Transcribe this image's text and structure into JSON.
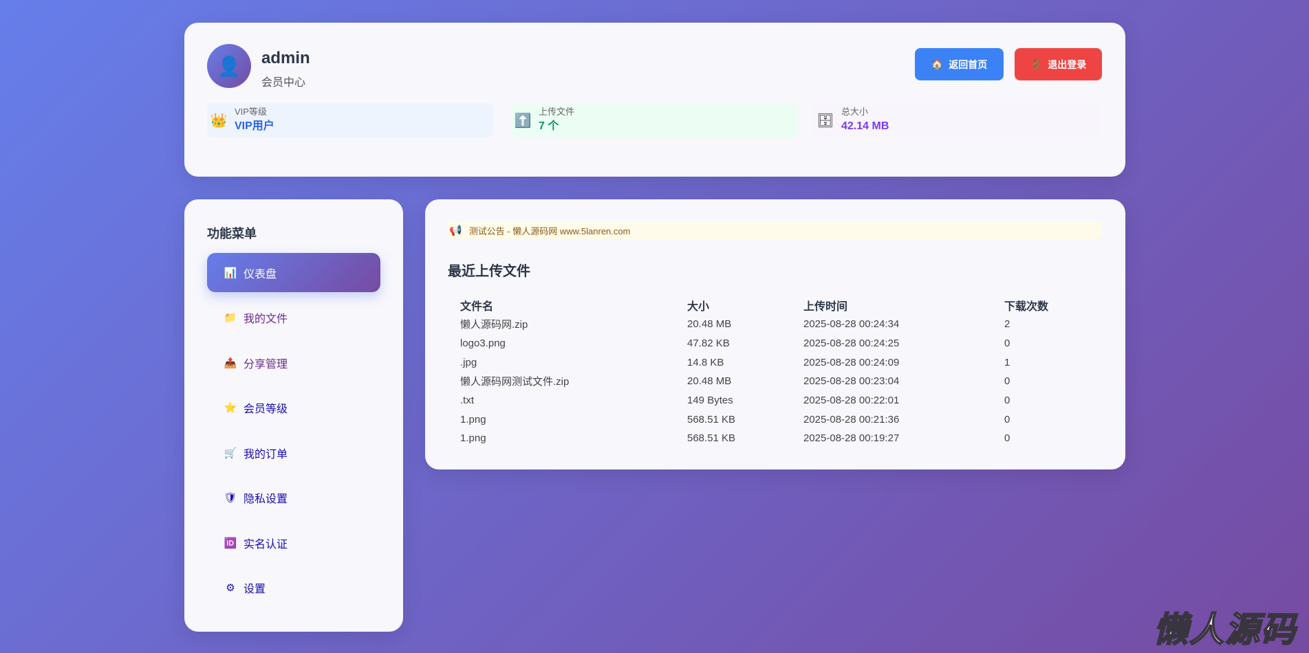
{
  "user": {
    "name": "admin",
    "subtitle": "会员中心",
    "avatar_icon": "person-icon"
  },
  "header": {
    "home_label": "返回首页",
    "logout_label": "退出登录"
  },
  "stats": [
    {
      "label": "VIP等级",
      "value": "VIP用户",
      "icon": "crown-icon",
      "color": "#2563eb",
      "bg": "#eef4fe"
    },
    {
      "label": "上传文件",
      "value": "7 个",
      "icon": "upload-arrow-icon",
      "color": "#059669",
      "bg": "#ecfdf3"
    },
    {
      "label": "总大小",
      "value": "42.14 MB",
      "icon": "storage-icon",
      "color": "#7c3aed",
      "bg": "#f8f5fd"
    }
  ],
  "sidebar": {
    "title": "功能菜单",
    "items": [
      {
        "label": "仪表盘",
        "icon": "chart-icon"
      },
      {
        "label": "我的文件",
        "icon": "folder-icon"
      },
      {
        "label": "分享管理",
        "icon": "share-upload-icon"
      },
      {
        "label": "会员等级",
        "icon": "star-icon"
      },
      {
        "label": "我的订单",
        "icon": "cart-icon"
      },
      {
        "label": "隐私设置",
        "icon": "shield-icon"
      },
      {
        "label": "实名认证",
        "icon": "id-icon"
      },
      {
        "label": "设置",
        "icon": "gear-icon"
      }
    ]
  },
  "main": {
    "notice": "测试公告 - 懒人源码网 www.5lanren.com",
    "section_title": "最近上传文件",
    "columns": [
      "文件名",
      "大小",
      "上传时间",
      "下载次数"
    ],
    "rows": [
      [
        "懒人源码网.zip",
        "20.48 MB",
        "2025-08-28 00:24:34",
        "2"
      ],
      [
        "logo3.png",
        "47.82 KB",
        "2025-08-28 00:24:25",
        "0"
      ],
      [
        ".jpg",
        "14.8 KB",
        "2025-08-28 00:24:09",
        "1"
      ],
      [
        "懒人源码网测试文件.zip",
        "20.48 MB",
        "2025-08-28 00:23:04",
        "0"
      ],
      [
        ".txt",
        "149 Bytes",
        "2025-08-28 00:22:01",
        "0"
      ],
      [
        "1.png",
        "568.51 KB",
        "2025-08-28 00:21:36",
        "0"
      ],
      [
        "1.png",
        "568.51 KB",
        "2025-08-28 00:19:27",
        "0"
      ]
    ]
  },
  "watermark": "懒人源码"
}
